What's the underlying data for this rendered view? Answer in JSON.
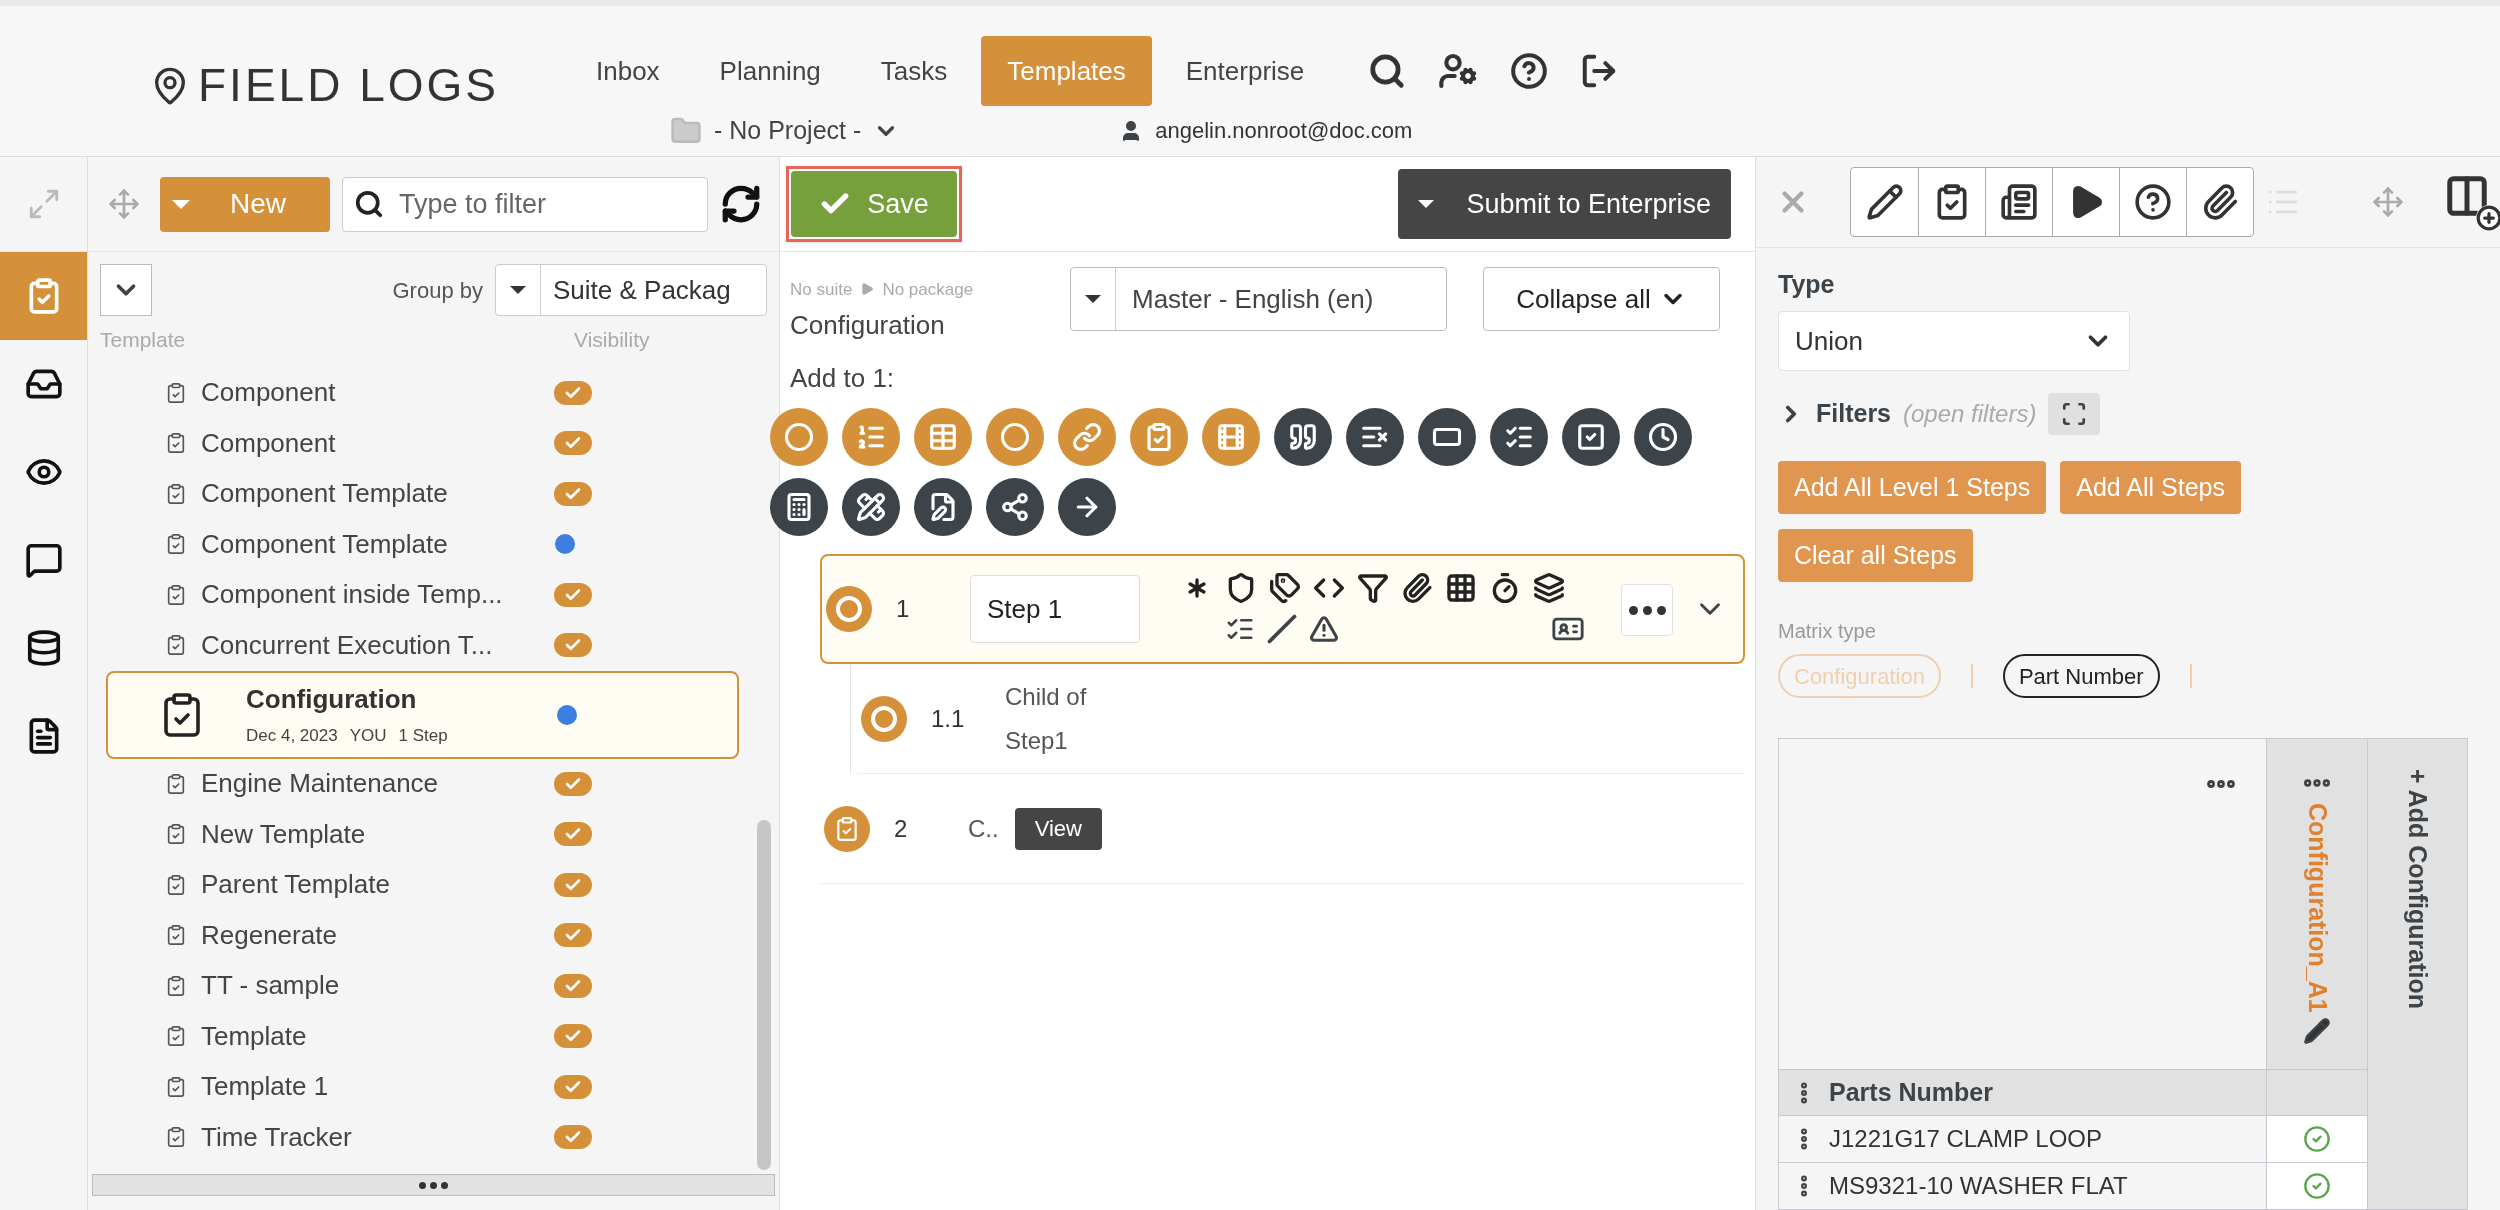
{
  "header": {
    "logo": "FIELD LOGS",
    "nav": [
      {
        "label": "Inbox",
        "selected": false
      },
      {
        "label": "Planning",
        "selected": false
      },
      {
        "label": "Tasks",
        "selected": false
      },
      {
        "label": "Templates",
        "selected": true
      },
      {
        "label": "Enterprise",
        "selected": false
      }
    ],
    "project": "- No Project -",
    "user": "angelin.nonroot@doc.com"
  },
  "rail": [
    {
      "selected": true
    },
    {
      "selected": false
    },
    {
      "selected": false
    },
    {
      "selected": false
    },
    {
      "selected": false
    },
    {
      "selected": false
    }
  ],
  "library": {
    "new_button": "New",
    "filter": {
      "placeholder": "Type to filter"
    },
    "group_by": {
      "label": "Group by",
      "value": "Suite & Packag"
    },
    "columns": [
      "Template",
      "Visibility"
    ],
    "templates": [
      {
        "name": "Component",
        "kind": "check",
        "selected": false
      },
      {
        "name": "Component",
        "kind": "check",
        "selected": false
      },
      {
        "name": "Component Template",
        "kind": "check",
        "selected": false
      },
      {
        "name": "Component Template",
        "kind": "dot",
        "selected": false
      },
      {
        "name": "Component inside Temp...",
        "kind": "check",
        "selected": false
      },
      {
        "name": "Concurrent Execution T...",
        "kind": "check",
        "selected": false
      },
      {
        "name": "Configuration",
        "kind": "dot",
        "selected": true,
        "date": "Dec 4, 2023",
        "owner": "YOU",
        "steps": "1 Step"
      },
      {
        "name": "Engine Maintenance",
        "kind": "check",
        "selected": false
      },
      {
        "name": "New Template",
        "kind": "check",
        "selected": false
      },
      {
        "name": "Parent Template",
        "kind": "check",
        "selected": false
      },
      {
        "name": "Regenerate",
        "kind": "check",
        "selected": false
      },
      {
        "name": "TT - sample",
        "kind": "check",
        "selected": false
      },
      {
        "name": "Template",
        "kind": "check",
        "selected": false
      },
      {
        "name": "Template 1",
        "kind": "check",
        "selected": false
      },
      {
        "name": "Time Tracker",
        "kind": "check",
        "selected": false
      }
    ]
  },
  "editor": {
    "save": "Save",
    "submit": "Submit to Enterprise",
    "suite": "No suite",
    "package": "No package",
    "title": "Configuration",
    "language": "Master - English (en)",
    "collapse": "Collapse all",
    "add_to": "Add to 1:",
    "tools": [
      {
        "color": "#d4913a"
      },
      {
        "color": "#d4913a"
      },
      {
        "color": "#d4913a"
      },
      {
        "color": "#d4913a"
      },
      {
        "color": "#d4913a"
      },
      {
        "color": "#d4913a"
      },
      {
        "color": "#d4913a"
      },
      {
        "color": "#3d4449"
      },
      {
        "color": "#3d4449"
      },
      {
        "color": "#3d4449"
      },
      {
        "color": "#3d4449"
      },
      {
        "color": "#3d4449"
      },
      {
        "color": "#3d4449"
      },
      {
        "color": "#3d4449"
      },
      {
        "color": "#3d4449"
      },
      {
        "color": "#3d4449"
      },
      {
        "color": "#3d4449"
      },
      {
        "color": "#3d4449"
      }
    ],
    "steps": [
      {
        "number": "1",
        "title": "Step 1",
        "kind": "input",
        "selected": true,
        "children": [
          {
            "number": "1.1",
            "title": "Child of Step1",
            "kind": "text",
            "selected": false
          }
        ]
      },
      {
        "number": "2",
        "title": "C..",
        "kind": "link",
        "selected": false,
        "action": "View"
      }
    ]
  },
  "inspector": {
    "type_label": "Type",
    "type_value": "Union",
    "filters_label": "Filters",
    "filters_hint": "(open filters)",
    "actions": [
      "Add All Level 1 Steps",
      "Add All Steps",
      "Clear all Steps"
    ],
    "matrix_type": {
      "label": "Matrix type",
      "options": [
        {
          "label": "Configuration",
          "selected": false
        },
        {
          "label": "Part Number",
          "selected": true
        }
      ]
    },
    "matrix": {
      "column": "Configuration_A1",
      "add_column": "+ Add Configuration",
      "row_header": "Parts Number",
      "rows": [
        {
          "part": "J1221G17 CLAMP LOOP",
          "checked": true
        },
        {
          "part": "MS9321-10 WASHER FLAT",
          "checked": true
        }
      ]
    }
  }
}
